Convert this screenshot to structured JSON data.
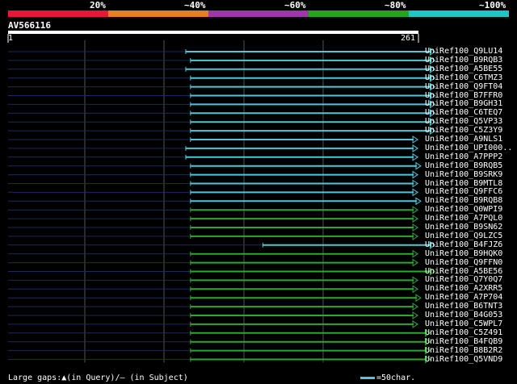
{
  "legend": {
    "labels": [
      "20%",
      "~40%",
      "~60%",
      "~80%",
      "~100%"
    ],
    "colors": [
      "#e8173a",
      "#e87e1c",
      "#9b3aa5",
      "#23a523",
      "#1fc6c6"
    ]
  },
  "query": {
    "id": "AV566116",
    "start_label": "1",
    "end_label": "261",
    "length": 261
  },
  "hits": [
    {
      "name": "UniRef100_Q9LU14",
      "start": 113,
      "end": 271,
      "color": "cyan"
    },
    {
      "name": "UniRef100_B9RQB3",
      "start": 116,
      "end": 271,
      "color": "cyan"
    },
    {
      "name": "UniRef100_A5BE55",
      "start": 113,
      "end": 271,
      "color": "cyan"
    },
    {
      "name": "UniRef100_C6TMZ3",
      "start": 116,
      "end": 271,
      "color": "cyan"
    },
    {
      "name": "UniRef100_Q9FT04",
      "start": 116,
      "end": 271,
      "color": "cyan"
    },
    {
      "name": "UniRef100_B7FFR0",
      "start": 116,
      "end": 271,
      "color": "cyan"
    },
    {
      "name": "UniRef100_B9GH31",
      "start": 116,
      "end": 271,
      "color": "cyan"
    },
    {
      "name": "UniRef100_C6TEQ7",
      "start": 116,
      "end": 271,
      "color": "cyan"
    },
    {
      "name": "UniRef100_Q5VP33",
      "start": 116,
      "end": 271,
      "color": "cyan"
    },
    {
      "name": "UniRef100_C5Z3Y9",
      "start": 116,
      "end": 271,
      "color": "cyan"
    },
    {
      "name": "UniRef100_A9NLS1",
      "start": 116,
      "end": 260,
      "color": "cyan"
    },
    {
      "name": "UniRef100_UPI000..",
      "start": 113,
      "end": 260,
      "color": "cyan"
    },
    {
      "name": "UniRef100_A7PPP2",
      "start": 113,
      "end": 260,
      "color": "cyan"
    },
    {
      "name": "UniRef100_B9RQB5",
      "start": 116,
      "end": 262,
      "color": "cyan"
    },
    {
      "name": "UniRef100_B9SRK9",
      "start": 116,
      "end": 260,
      "color": "cyan"
    },
    {
      "name": "UniRef100_B9MTL8",
      "start": 116,
      "end": 260,
      "color": "cyan"
    },
    {
      "name": "UniRef100_Q9FFC6",
      "start": 116,
      "end": 260,
      "color": "cyan"
    },
    {
      "name": "UniRef100_B9RQB8",
      "start": 116,
      "end": 262,
      "color": "cyan"
    },
    {
      "name": "UniRef100_Q0WPI9",
      "start": 116,
      "end": 260,
      "color": "green"
    },
    {
      "name": "UniRef100_A7PQL0",
      "start": 116,
      "end": 260,
      "color": "green"
    },
    {
      "name": "UniRef100_B9SN62",
      "start": 116,
      "end": 260,
      "color": "green"
    },
    {
      "name": "UniRef100_Q9LZC5",
      "start": 116,
      "end": 260,
      "color": "green"
    },
    {
      "name": "UniRef100_B4FJZ6",
      "start": 162,
      "end": 271,
      "color": "cyan"
    },
    {
      "name": "UniRef100_B9HQK0",
      "start": 116,
      "end": 260,
      "color": "green"
    },
    {
      "name": "UniRef100_Q9FFN0",
      "start": 116,
      "end": 260,
      "color": "green"
    },
    {
      "name": "UniRef100_A5BE56",
      "start": 116,
      "end": 271,
      "color": "green"
    },
    {
      "name": "UniRef100_Q7Y0Q7",
      "start": 116,
      "end": 260,
      "color": "green"
    },
    {
      "name": "UniRef100_A2XRR5",
      "start": 116,
      "end": 260,
      "color": "green"
    },
    {
      "name": "UniRef100_A7P704",
      "start": 116,
      "end": 262,
      "color": "green"
    },
    {
      "name": "UniRef100_B6TNT3",
      "start": 116,
      "end": 260,
      "color": "green"
    },
    {
      "name": "UniRef100_B4G053",
      "start": 116,
      "end": 260,
      "color": "green"
    },
    {
      "name": "UniRef100_C5WPL7",
      "start": 116,
      "end": 260,
      "color": "green"
    },
    {
      "name": "UniRef100_C5Z491",
      "start": 116,
      "end": 268,
      "color": "green"
    },
    {
      "name": "UniRef100_B4FQB9",
      "start": 116,
      "end": 268,
      "color": "green"
    },
    {
      "name": "UniRef100_B8B2R2",
      "start": 116,
      "end": 268,
      "color": "green"
    },
    {
      "name": "UniRef100_Q5VND9",
      "start": 116,
      "end": 268,
      "color": "green"
    }
  ],
  "line_colors": {
    "cyan": "#4ec8d8",
    "green": "#2ea82e",
    "track": "#1a2a5a",
    "grid": "#555555"
  },
  "footer": {
    "gaps_text": "Large gaps:▲(in Query)/— (in Subject)",
    "scale_text": "=50char."
  }
}
